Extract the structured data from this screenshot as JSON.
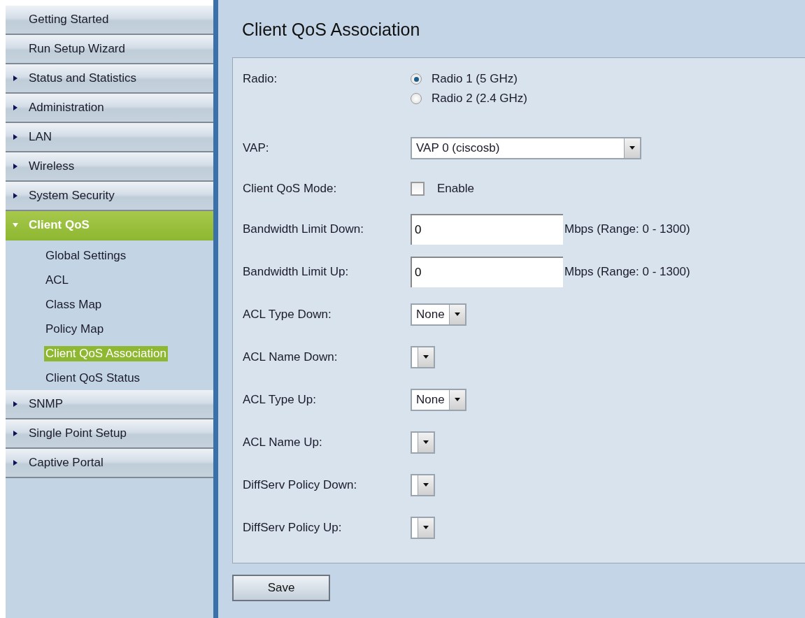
{
  "sidebar": {
    "items": [
      {
        "label": "Getting Started",
        "kind": "link"
      },
      {
        "label": "Run Setup Wizard",
        "kind": "link"
      },
      {
        "label": "Status and Statistics",
        "kind": "section",
        "expanded": false,
        "selected": false
      },
      {
        "label": "Administration",
        "kind": "section",
        "expanded": false,
        "selected": false
      },
      {
        "label": "LAN",
        "kind": "section",
        "expanded": false,
        "selected": false
      },
      {
        "label": "Wireless",
        "kind": "section",
        "expanded": false,
        "selected": false
      },
      {
        "label": "System Security",
        "kind": "section",
        "expanded": false,
        "selected": false
      },
      {
        "label": "Client QoS",
        "kind": "section",
        "expanded": true,
        "selected": true,
        "children": [
          {
            "label": "Global Settings",
            "selected": false
          },
          {
            "label": "ACL",
            "selected": false
          },
          {
            "label": "Class Map",
            "selected": false
          },
          {
            "label": "Policy Map",
            "selected": false
          },
          {
            "label": "Client QoS Association",
            "selected": true
          },
          {
            "label": "Client QoS Status",
            "selected": false
          }
        ]
      },
      {
        "label": "SNMP",
        "kind": "section",
        "expanded": false,
        "selected": false
      },
      {
        "label": "Single Point Setup",
        "kind": "section",
        "expanded": false,
        "selected": false
      },
      {
        "label": "Captive Portal",
        "kind": "section",
        "expanded": false,
        "selected": false
      }
    ]
  },
  "page": {
    "title": "Client QoS Association"
  },
  "form": {
    "rows": [
      {
        "label": "Radio:",
        "kind": "radio",
        "options": [
          {
            "label": "Radio 1 (5 GHz)",
            "selected": true
          },
          {
            "label": "Radio 2 (2.4 GHz)",
            "selected": false
          }
        ]
      },
      {
        "label": "VAP:",
        "kind": "select",
        "value": "VAP 0 (ciscosb)"
      },
      {
        "label": "Client QoS Mode:",
        "kind": "checkbox",
        "checked": false,
        "option": "Enable"
      },
      {
        "label": "Bandwidth Limit Down:",
        "kind": "text",
        "value": "0",
        "hint": "Mbps (Range: 0 - 1300)"
      },
      {
        "label": "Bandwidth Limit Up:",
        "kind": "text",
        "value": "0",
        "hint": "Mbps (Range: 0 - 1300)"
      },
      {
        "label": "ACL Type Down:",
        "kind": "select",
        "value": "None"
      },
      {
        "label": "ACL Name Down:",
        "kind": "select"
      },
      {
        "label": "ACL Type Up:",
        "kind": "select",
        "value": "None"
      },
      {
        "label": "ACL Name Up:",
        "kind": "select"
      },
      {
        "label": "DiffServ Policy Down:",
        "kind": "select"
      },
      {
        "label": "DiffServ Policy Up:",
        "kind": "select"
      }
    ]
  },
  "buttons": [
    "Save"
  ]
}
